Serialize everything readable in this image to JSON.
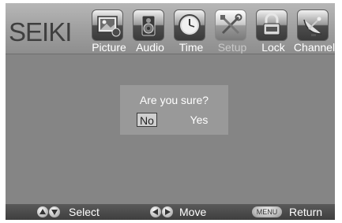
{
  "brand": "SEIKI",
  "menu": [
    {
      "label": "Picture",
      "icon": "picture-icon",
      "active": false
    },
    {
      "label": "Audio",
      "icon": "speaker-icon",
      "active": false
    },
    {
      "label": "Time",
      "icon": "clock-icon",
      "active": false
    },
    {
      "label": "Setup",
      "icon": "tools-icon",
      "active": true
    },
    {
      "label": "Lock",
      "icon": "lock-icon",
      "active": false
    },
    {
      "label": "Channel",
      "icon": "satellite-dish-icon",
      "active": false
    }
  ],
  "dialog": {
    "question": "Are you sure?",
    "no_label": "No",
    "yes_label": "Yes",
    "selected": "No"
  },
  "footer": {
    "select_label": "Select",
    "move_label": "Move",
    "menu_key": "MENU",
    "return_label": "Return"
  },
  "colors": {
    "screen_bg": "#858585",
    "dialog_bg": "#999999",
    "header_bg": "#a8a8a8",
    "footer_bg": "#4a4a4a"
  }
}
